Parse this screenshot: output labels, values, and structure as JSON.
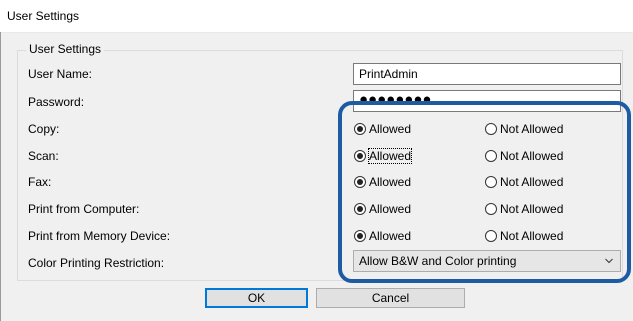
{
  "window": {
    "title": "User Settings"
  },
  "group": {
    "label": "User Settings"
  },
  "fields": {
    "user_name_label": "User Name:",
    "user_name_value": "PrintAdmin",
    "password_label": "Password:",
    "password_value": "●●●●●●●●"
  },
  "permissions": [
    {
      "label": "Copy:",
      "selected": "Allowed"
    },
    {
      "label": "Scan:",
      "selected": "Allowed"
    },
    {
      "label": "Fax:",
      "selected": "Allowed"
    },
    {
      "label": "Print from Computer:",
      "selected": "Allowed"
    },
    {
      "label": "Print from Memory Device:",
      "selected": "Allowed"
    }
  ],
  "options": {
    "allowed": "Allowed",
    "not_allowed": "Not Allowed"
  },
  "color_restriction": {
    "label": "Color Printing Restriction:",
    "selected": "Allow B&W and Color printing"
  },
  "buttons": {
    "ok": "OK",
    "cancel": "Cancel"
  },
  "colors": {
    "highlight": "#1d5ca3",
    "default_button_border": "#0078d7"
  }
}
